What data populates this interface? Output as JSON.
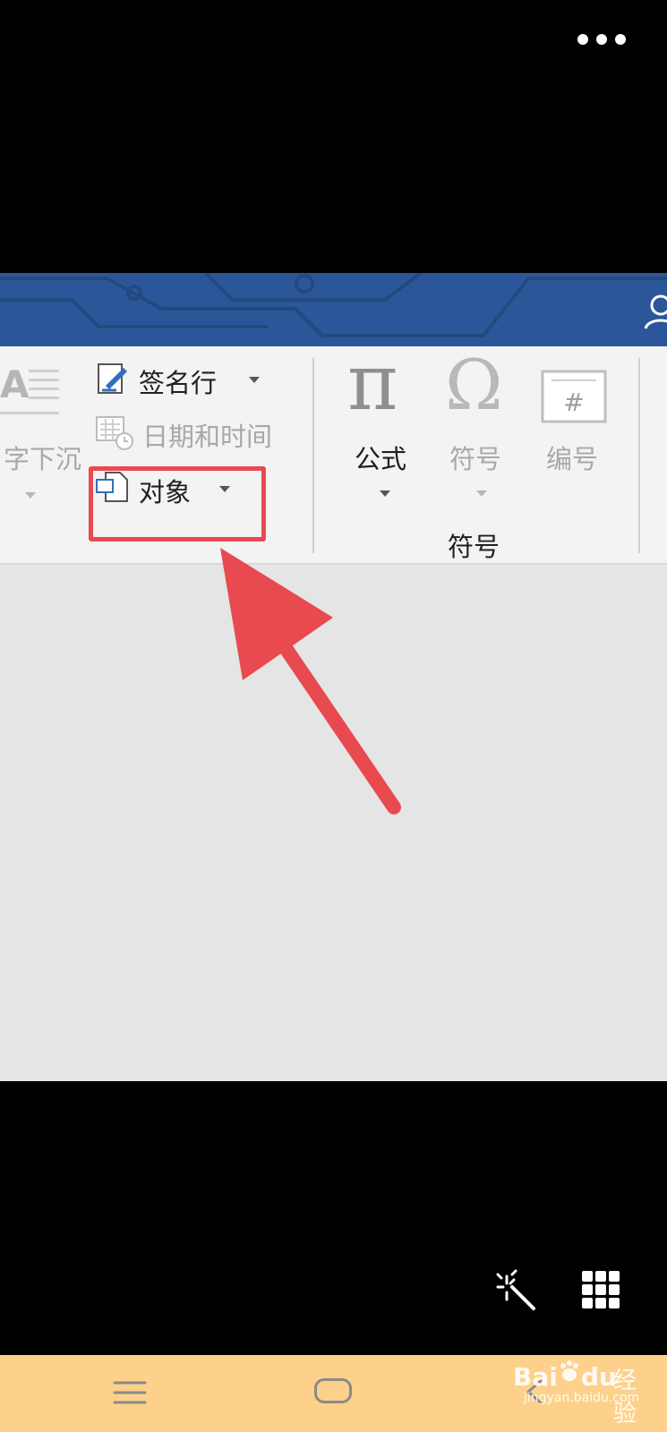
{
  "ribbon": {
    "partial_label": "字下沉",
    "signature_line_label": "签名行",
    "datetime_label": "日期和时间",
    "object_label": "对象",
    "equation_label": "公式",
    "symbol_label": "符号",
    "number_label": "编号",
    "symbols_group_label": "符号"
  },
  "watermark": {
    "brand_text": "Bai",
    "brand_text_2": "du",
    "cn_text": "经验",
    "url": "jingyan.baidu.com"
  },
  "colors": {
    "ribbon_title_bar": "#2b579a",
    "annotation_red": "#e84a4f",
    "nav_bar": "#fdd18b"
  },
  "icons": [
    "more-icon",
    "user-icon",
    "drop-cap-icon",
    "signature-line-icon",
    "date-time-icon",
    "object-icon",
    "pi-icon",
    "omega-icon",
    "number-icon",
    "magic-wand-icon",
    "grid-icon",
    "menu-icon",
    "home-icon",
    "back-icon",
    "paw-icon"
  ]
}
